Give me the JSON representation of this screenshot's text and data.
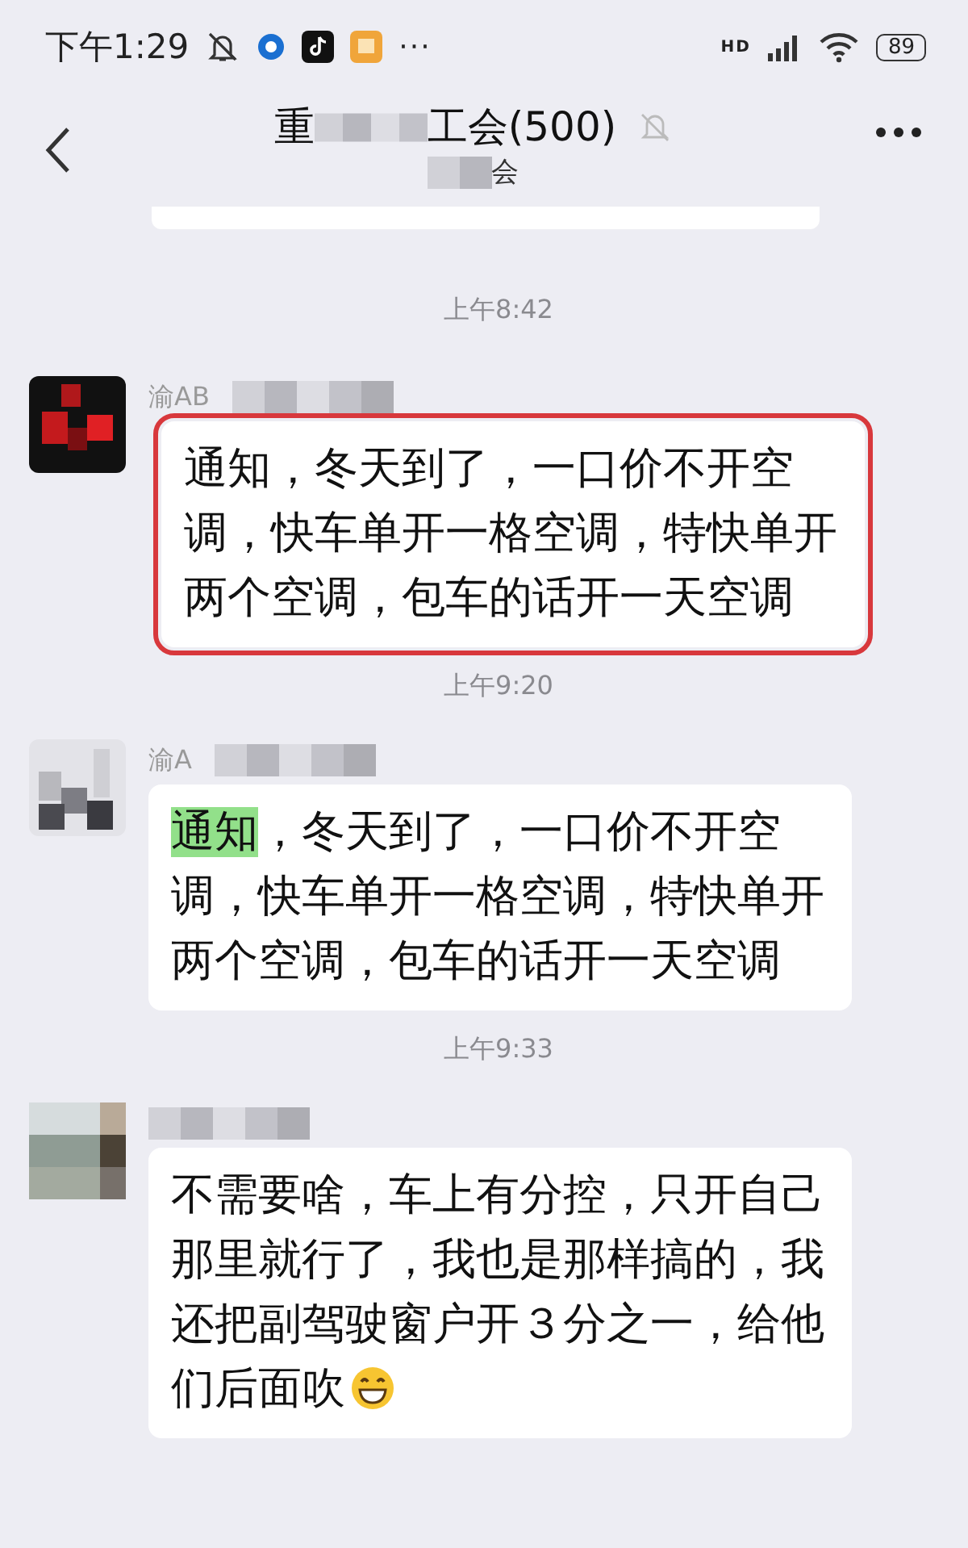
{
  "status_bar": {
    "time": "下午1:29",
    "more": "···",
    "network": "HD",
    "battery": "89"
  },
  "header": {
    "title_start": "重",
    "title_end": "工会(500)",
    "subtitle": "会",
    "muted": true
  },
  "messages": [
    {
      "kind": "time",
      "text": "上午8:42"
    },
    {
      "kind": "message",
      "sender": "渝AB",
      "outlined": true,
      "segments": [
        {
          "text": "通知",
          "highlighted": false
        },
        {
          "text": "，冬天到了，一口价不开空调，快车单开一格空调，特快单开两个空调，包车的话开一天空调",
          "highlighted": false
        }
      ]
    },
    {
      "kind": "time",
      "text": "上午9:20"
    },
    {
      "kind": "message",
      "sender": "渝A",
      "outlined": false,
      "segments": [
        {
          "text": "通知",
          "highlighted": true
        },
        {
          "text": "，冬天到了，一口价不开空调，快车单开一格空调，特快单开两个空调，包车的话开一天空调",
          "highlighted": false
        }
      ]
    },
    {
      "kind": "time",
      "text": "上午9:33"
    },
    {
      "kind": "message",
      "outlined": false,
      "emoji": true,
      "segments": [
        {
          "text": "不需要啥，车上有分控，只开自己那里就行了，我也是那样搞的，我还把副驾驶窗户开３分之一，给他们后面吹",
          "highlighted": false
        }
      ]
    }
  ]
}
